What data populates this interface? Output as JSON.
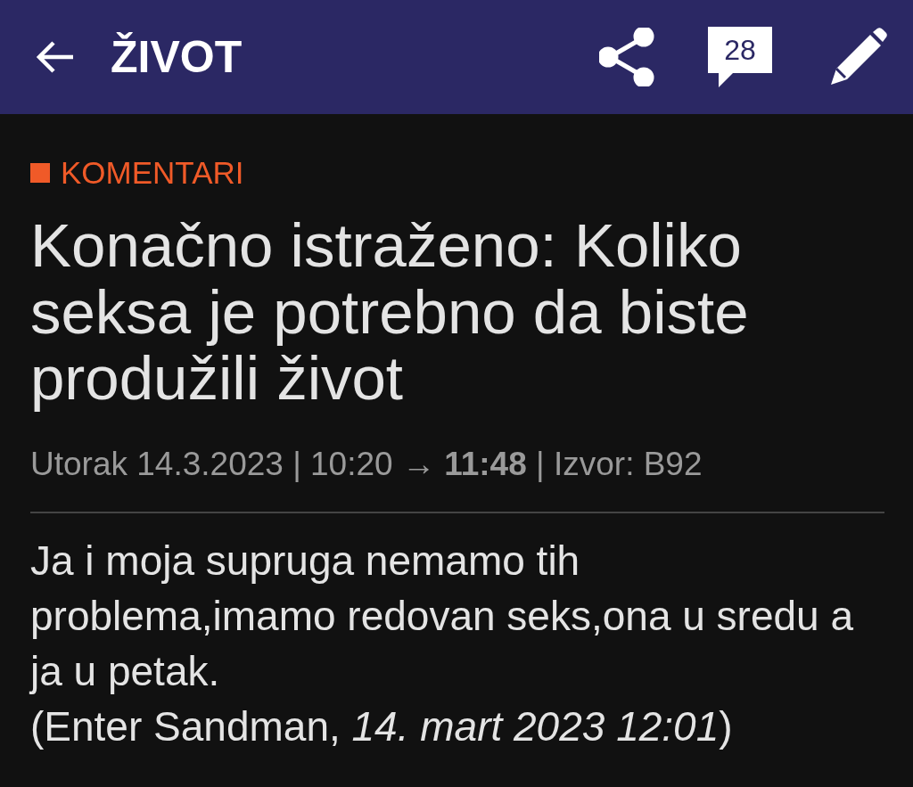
{
  "app_bar": {
    "title": "ŽIVOT",
    "comment_count": "28"
  },
  "section_label": "KOMENTARI",
  "article_title": "Konačno istraženo: Koliko seksa je potrebno da biste produžili život",
  "meta": "Utorak 14.3.2023 | 10:20 → **11:48** | Izvor: B92",
  "comment": {
    "text": "Ja i moja supruga nemamo tih problema,imamo redovan seks,ona u sredu a ja u petak.",
    "signature": "(Enter Sandman, *14. mart 2023 12:01*)"
  }
}
